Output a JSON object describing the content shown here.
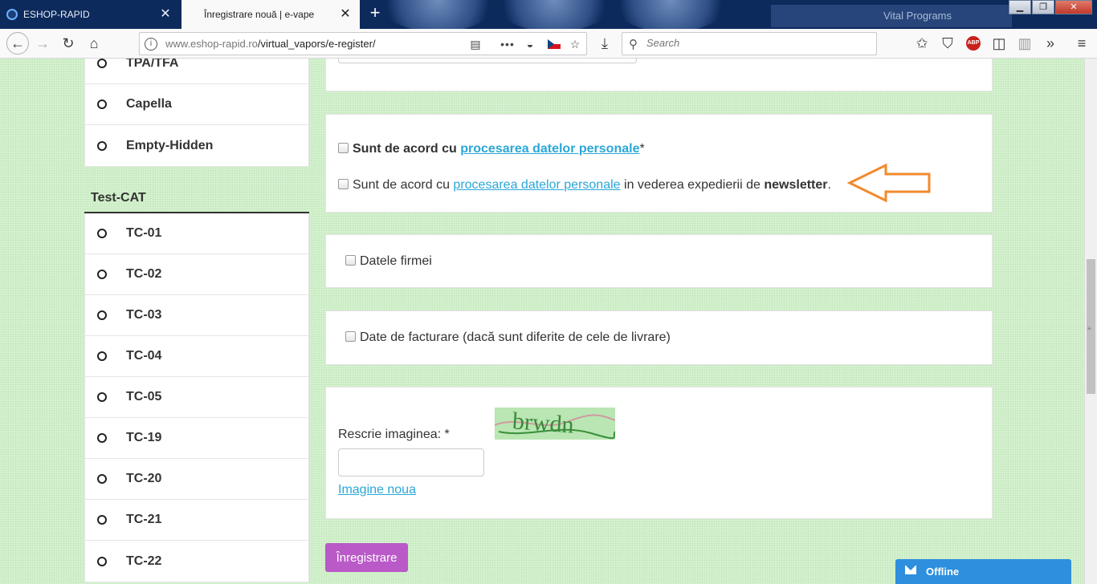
{
  "browser": {
    "tabs": [
      {
        "title": "ESHOP-RAPID",
        "active": false
      },
      {
        "title": "Înregistrare nouă | e-vape",
        "active": true
      }
    ],
    "banner_text": "Vital Programs",
    "url_domain": "www.eshop-rapid.ro",
    "url_path": "/virtual_vapors/e-register/",
    "search_placeholder": "Search",
    "abp_label": "ABP",
    "menu_dots": "•••"
  },
  "sidebar": {
    "top_items": [
      "TPA/TFA",
      "Capella",
      "Empty-Hidden"
    ],
    "category_title": "Test-CAT",
    "category_items": [
      "TC-01",
      "TC-02",
      "TC-03",
      "TC-04",
      "TC-05",
      "TC-19",
      "TC-20",
      "TC-21",
      "TC-22"
    ]
  },
  "form": {
    "consent": {
      "prefix": "Sunt de acord cu",
      "link": "procesarea datelor personale",
      "required_mark": "*"
    },
    "newsletter": {
      "prefix": "Sunt de acord cu",
      "link": "procesarea datelor personale",
      "middle": "in vederea expedierii de",
      "bold": "newsletter",
      "suffix": "."
    },
    "company_label": "Datele firmei",
    "billing_label": "Date de facturare (dacă sunt diferite de cele de livrare)",
    "captcha": {
      "label": "Rescrie imaginea: *",
      "text": "brwdn",
      "refresh_link": "Imagine noua"
    },
    "submit_label": "Înregistrare"
  },
  "chat": {
    "status": "Offline"
  },
  "colors": {
    "page_bg": "#d6f2d0",
    "link": "#2aa7d8",
    "submit": "#b95ac8",
    "chat": "#2d8fdd",
    "arrow": "#f28a2e"
  }
}
